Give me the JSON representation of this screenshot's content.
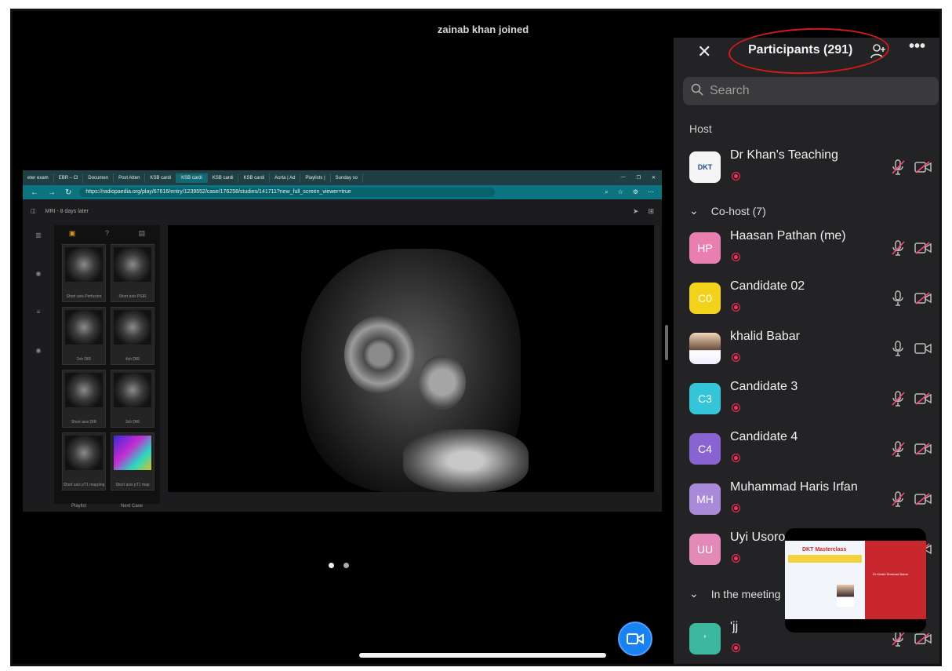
{
  "notification": "zainab khan joined",
  "browser": {
    "tabs": [
      "eter exam",
      "EBR – Cl",
      "Documen",
      "Post Atten",
      "KSB cardi",
      "KSB cardi",
      "KSB cardi",
      "KSB cardi",
      "Aorta | Ad",
      "Playlists |",
      "Sunday so"
    ],
    "active_tab_index": 5,
    "url": "https://radiopaedia.org/play/67616/entry/1239552/case/176258/studies/141711?new_full_screen_viewer=true"
  },
  "viewer": {
    "study_label": "MRI - 8 days later",
    "thumbnails": [
      {
        "caption": "Short axis Perfusion",
        "color": false
      },
      {
        "caption": "Short axis PSIR",
        "color": false
      },
      {
        "caption": "2ch DIR",
        "color": false
      },
      {
        "caption": "4ch DIR",
        "color": false
      },
      {
        "caption": "Short axis DIR",
        "color": false
      },
      {
        "caption": "3ch DIR",
        "color": false
      },
      {
        "caption": "Short axis pT1 mapping",
        "color": false
      },
      {
        "caption": "Short axis pT1 map",
        "color": true
      }
    ],
    "playlist_label": "Playlist",
    "next_case_label": "Next Case"
  },
  "panel": {
    "title": "Participants (291)",
    "search_placeholder": "Search",
    "host_label": "Host",
    "cohost_label": "Co-host (7)",
    "meeting_label": "In the meeting",
    "participants": [
      {
        "name": "Dr Khan's Teaching",
        "initials": "",
        "avatar_color": "",
        "avatar_type": "logo",
        "avatar_text": "DKT",
        "muted": true,
        "video_off": true
      },
      {
        "name": "Haasan Pathan (me)",
        "initials": "HP",
        "avatar_color": "#e87fb0",
        "avatar_type": "initials",
        "muted": true,
        "video_off": true
      },
      {
        "name": "Candidate 02",
        "initials": "C0",
        "avatar_color": "#f2d21a",
        "avatar_type": "initials",
        "muted": false,
        "video_off": true
      },
      {
        "name": "khalid Babar",
        "initials": "",
        "avatar_color": "",
        "avatar_type": "photo",
        "muted": false,
        "video_off": false
      },
      {
        "name": "Candidate 3",
        "initials": "C3",
        "avatar_color": "#35c5d8",
        "avatar_type": "initials",
        "muted": true,
        "video_off": true
      },
      {
        "name": "Candidate 4",
        "initials": "C4",
        "avatar_color": "#8a63d2",
        "avatar_type": "initials",
        "muted": true,
        "video_off": true
      },
      {
        "name": "Muhammad Haris Irfan",
        "initials": "MH",
        "avatar_color": "#a88ad8",
        "avatar_type": "initials",
        "muted": true,
        "video_off": true
      },
      {
        "name": "Uyi Usoro",
        "initials": "UU",
        "avatar_color": "#e48ab8",
        "avatar_type": "initials",
        "muted": true,
        "video_off": true
      },
      {
        "name": "'jj",
        "initials": "'",
        "avatar_color": "#3cb89e",
        "avatar_type": "initials",
        "muted": true,
        "video_off": true
      }
    ]
  },
  "slide": {
    "title": "DKT Masterclass",
    "right_text": "Dr Khalid Shahzad Babar"
  },
  "colors": {
    "accent": "#1a82f0",
    "recording": "#ff2e55",
    "annotation": "#d31a1a"
  }
}
